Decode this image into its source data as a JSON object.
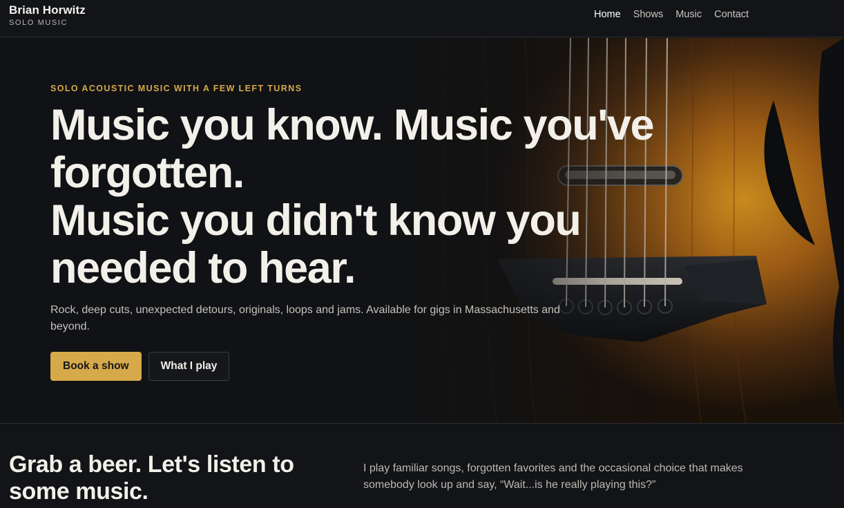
{
  "header": {
    "brand_name": "Brian Horwitz",
    "brand_sub": "SOLO MUSIC",
    "nav": [
      {
        "label": "Home",
        "active": true
      },
      {
        "label": "Shows",
        "active": false
      },
      {
        "label": "Music",
        "active": false
      },
      {
        "label": "Contact",
        "active": false
      }
    ]
  },
  "hero": {
    "eyebrow": "SOLO ACOUSTIC MUSIC WITH A FEW LEFT TURNS",
    "title_line1": "Music you know. Music you've forgotten.",
    "title_line2": "Music you didn't know you needed to hear.",
    "lead": "Rock, deep cuts, unexpected detours, originals, loops and jams. Available for gigs in Massachusetts and beyond.",
    "primary_button": "Book a show",
    "secondary_button": "What I play",
    "image_icon": "acoustic-guitar-image"
  },
  "intro": {
    "heading": "Grab a beer. Let's listen to some music.",
    "text": "I play familiar songs, forgotten favorites and the occasional choice that makes somebody look up and say, “Wait...is he really playing this?”"
  },
  "colors": {
    "accent": "#d6a94a",
    "background": "#121417",
    "text": "#f3f0ea"
  }
}
